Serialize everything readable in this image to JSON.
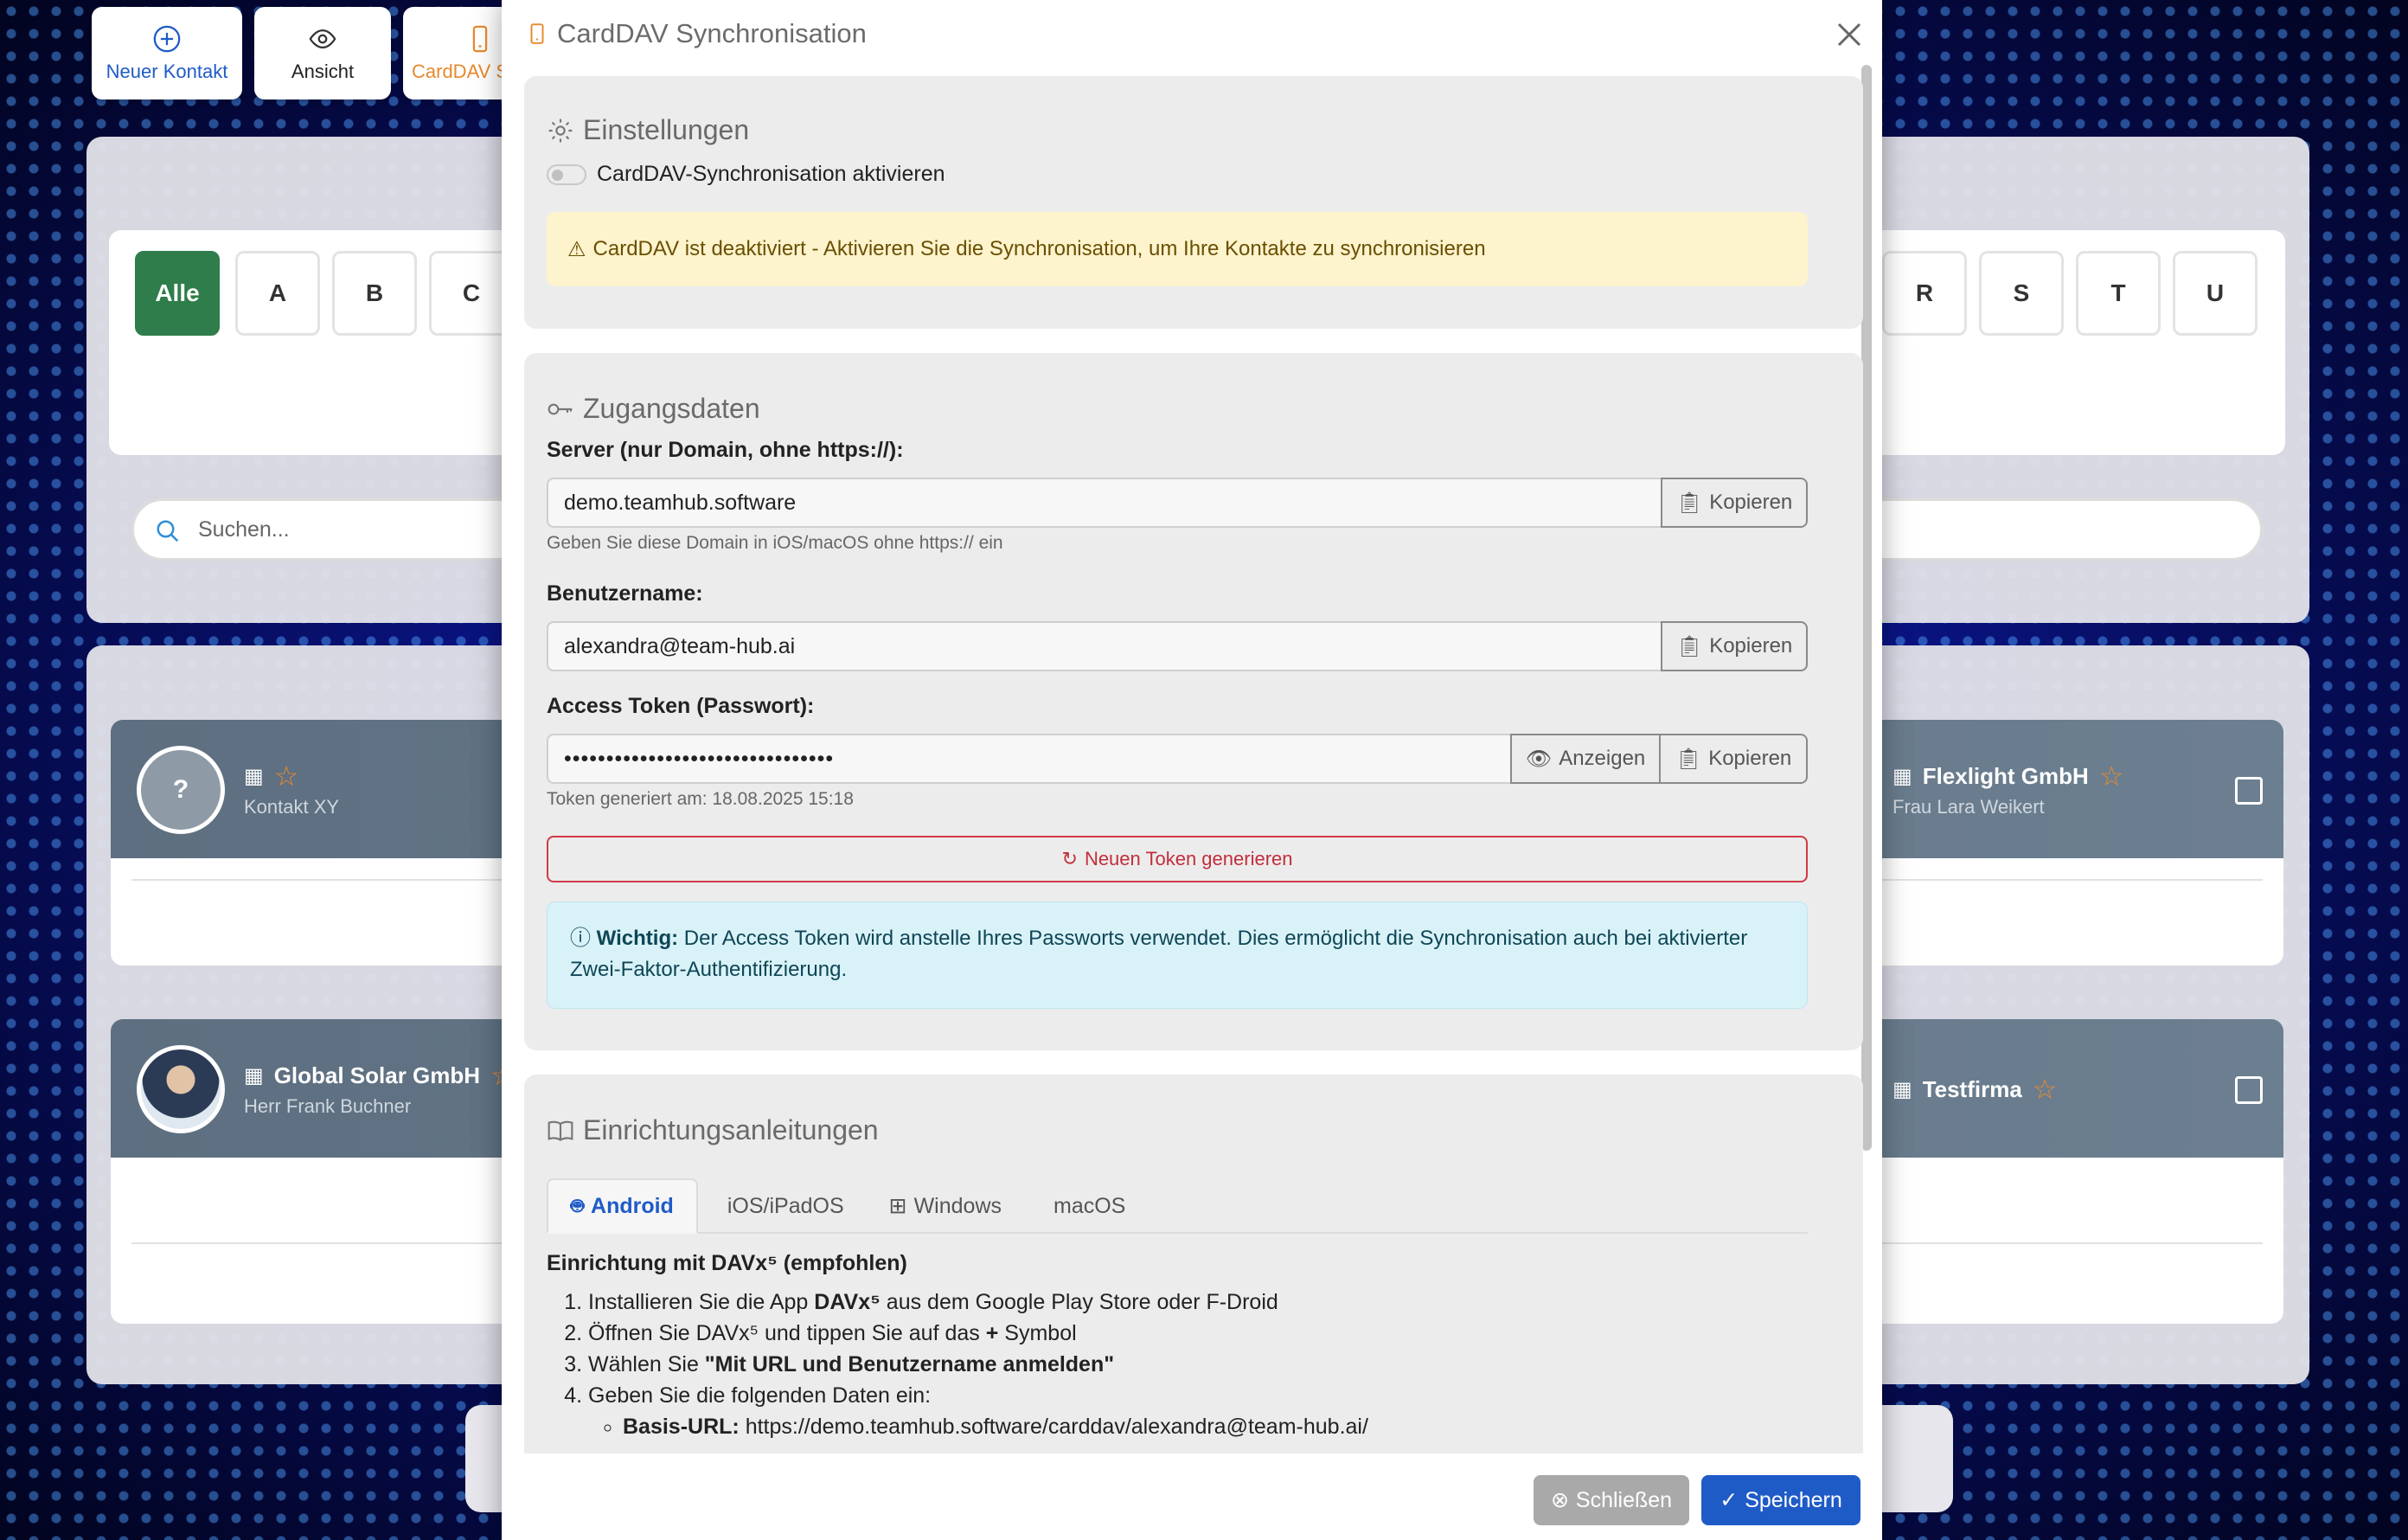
{
  "toolbar": {
    "new_contact": "Neuer Kontakt",
    "view": "Ansicht",
    "carddav": "CardDAV S"
  },
  "filter": {
    "letters": [
      "Alle",
      "A",
      "B",
      "C",
      "R",
      "S",
      "T",
      "U"
    ]
  },
  "search": {
    "placeholder": "Suchen..."
  },
  "contacts": [
    {
      "name": "",
      "sub": "Kontakt XY",
      "avatar": "?"
    },
    {
      "name": "Flexlight GmbH",
      "sub": "Frau Lara Weikert"
    },
    {
      "name": "Global Solar GmbH",
      "sub": "Herr Frank Buchner"
    },
    {
      "name": "Testfirma",
      "sub": ""
    }
  ],
  "modal": {
    "title": "CardDAV Synchronisation",
    "settings": {
      "title": "Einstellungen",
      "toggle_label": "CardDAV-Synchronisation aktivieren",
      "warning": "CardDAV ist deaktiviert - Aktivieren Sie die Synchronisation, um Ihre Kontakte zu synchronisieren"
    },
    "access": {
      "title": "Zugangsdaten",
      "server_label": "Server (nur Domain, ohne https://):",
      "server_value": "demo.teamhub.software",
      "server_hint": "Geben Sie diese Domain in iOS/macOS ohne https:// ein",
      "username_label": "Benutzername:",
      "username_value": "alexandra@team-hub.ai",
      "token_label": "Access Token (Passwort):",
      "token_value": "••••••••••••••••••••••••••••••••",
      "token_hint": "Token generiert am: 18.08.2025 15:18",
      "copy": "Kopieren",
      "show": "Anzeigen",
      "regenerate": "Neuen Token generieren",
      "info_bold": "Wichtig:",
      "info_text": "Der Access Token wird anstelle Ihres Passworts verwendet. Dies ermöglicht die Synchronisation auch bei aktivierter Zwei-Faktor-Authentifizierung."
    },
    "guides": {
      "title": "Einrichtungsanleitungen",
      "tabs": [
        "Android",
        "iOS/iPadOS",
        "Windows",
        "macOS"
      ],
      "heading": "Einrichtung mit DAVx⁵ (empfohlen)",
      "steps": [
        {
          "pre": "Installieren Sie die App ",
          "bold": "DAVx⁵",
          "post": " aus dem Google Play Store oder F-Droid"
        },
        {
          "pre": "Öffnen Sie DAVx⁵ und tippen Sie auf das ",
          "bold": "+",
          "post": " Symbol"
        },
        {
          "pre": "Wählen Sie ",
          "bold": "\"Mit URL und Benutzername anmelden\"",
          "post": ""
        },
        {
          "pre": "Geben Sie die folgenden Daten ein:",
          "bold": "",
          "post": ""
        }
      ],
      "base_url_label": "Basis-URL:",
      "base_url": "https://demo.teamhub.software/carddav/alexandra@team-hub.ai/"
    },
    "footer": {
      "close": "Schließen",
      "save": "Speichern"
    }
  },
  "colors": {
    "accent_blue": "#1f5bc7",
    "accent_orange": "#e8892d",
    "active_green": "#2e7d4a",
    "danger": "#c22e3b"
  }
}
